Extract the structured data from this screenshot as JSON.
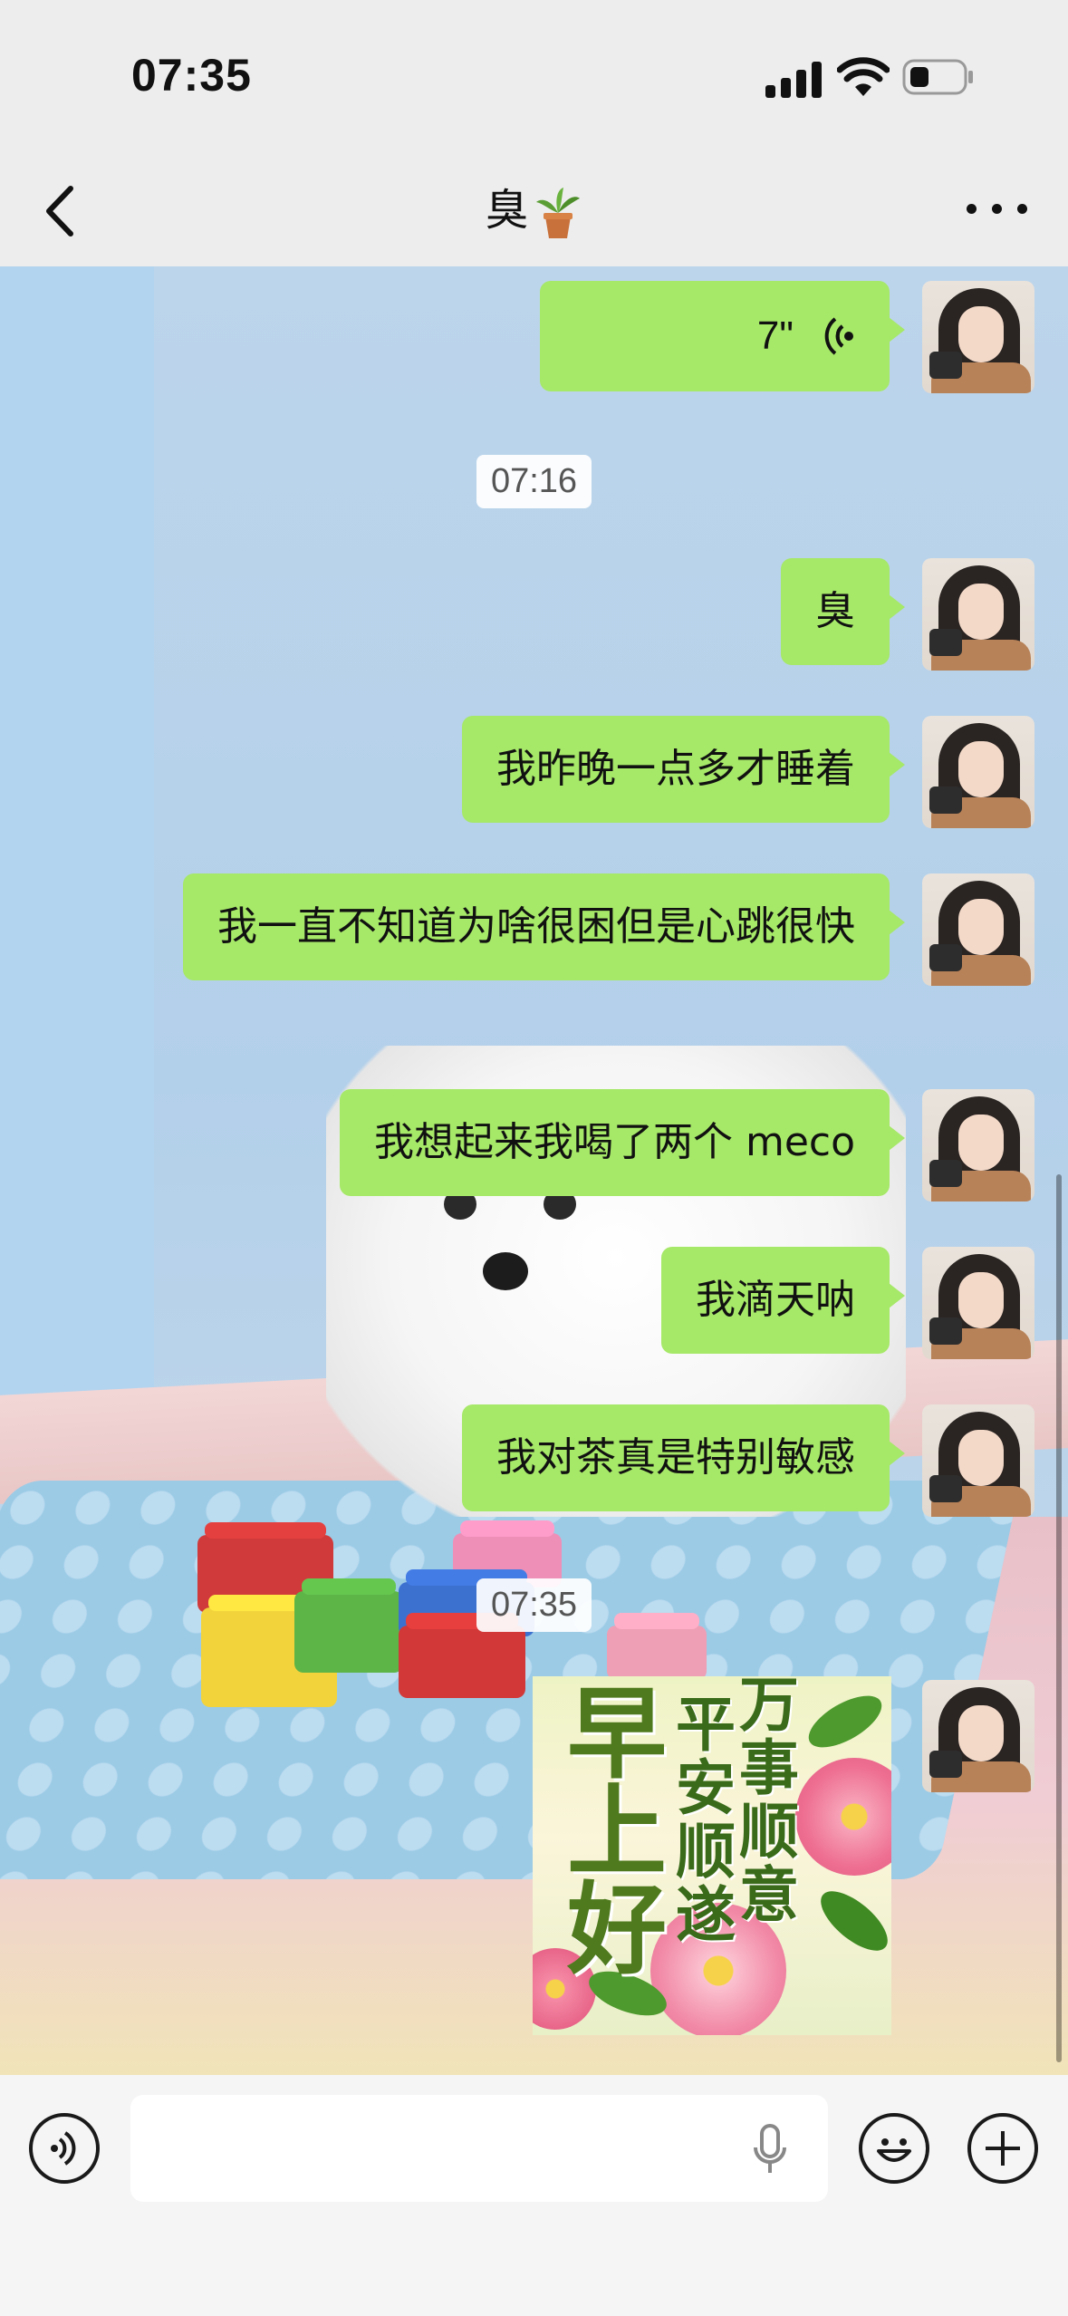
{
  "status_bar": {
    "time": "07:35",
    "battery_level": 0.3,
    "signal_bars": 4
  },
  "nav": {
    "title": "臭",
    "title_emoji": "potted-plant-icon"
  },
  "messages": [
    {
      "type": "voice",
      "duration": "7\""
    },
    {
      "type": "timestamp",
      "text": "07:16"
    },
    {
      "type": "text",
      "text": "臭"
    },
    {
      "type": "text",
      "text": "我昨晚一点多才睡着"
    },
    {
      "type": "text",
      "text": "我一直不知道为啥很困但是心跳很快"
    },
    {
      "type": "text",
      "text": "我想起来我喝了两个 meco"
    },
    {
      "type": "text",
      "text": "我滴天呐"
    },
    {
      "type": "text",
      "text": "我对茶真是特别敏感"
    },
    {
      "type": "timestamp",
      "text": "07:35"
    },
    {
      "type": "sticker",
      "big_text": "早上好",
      "col1": "平安顺遂",
      "col2": "万事顺意"
    }
  ],
  "input": {
    "placeholder": ""
  },
  "colors": {
    "bubble": "#a6e868",
    "chrome": "#ededed",
    "input_bar": "#f5f5f5"
  }
}
